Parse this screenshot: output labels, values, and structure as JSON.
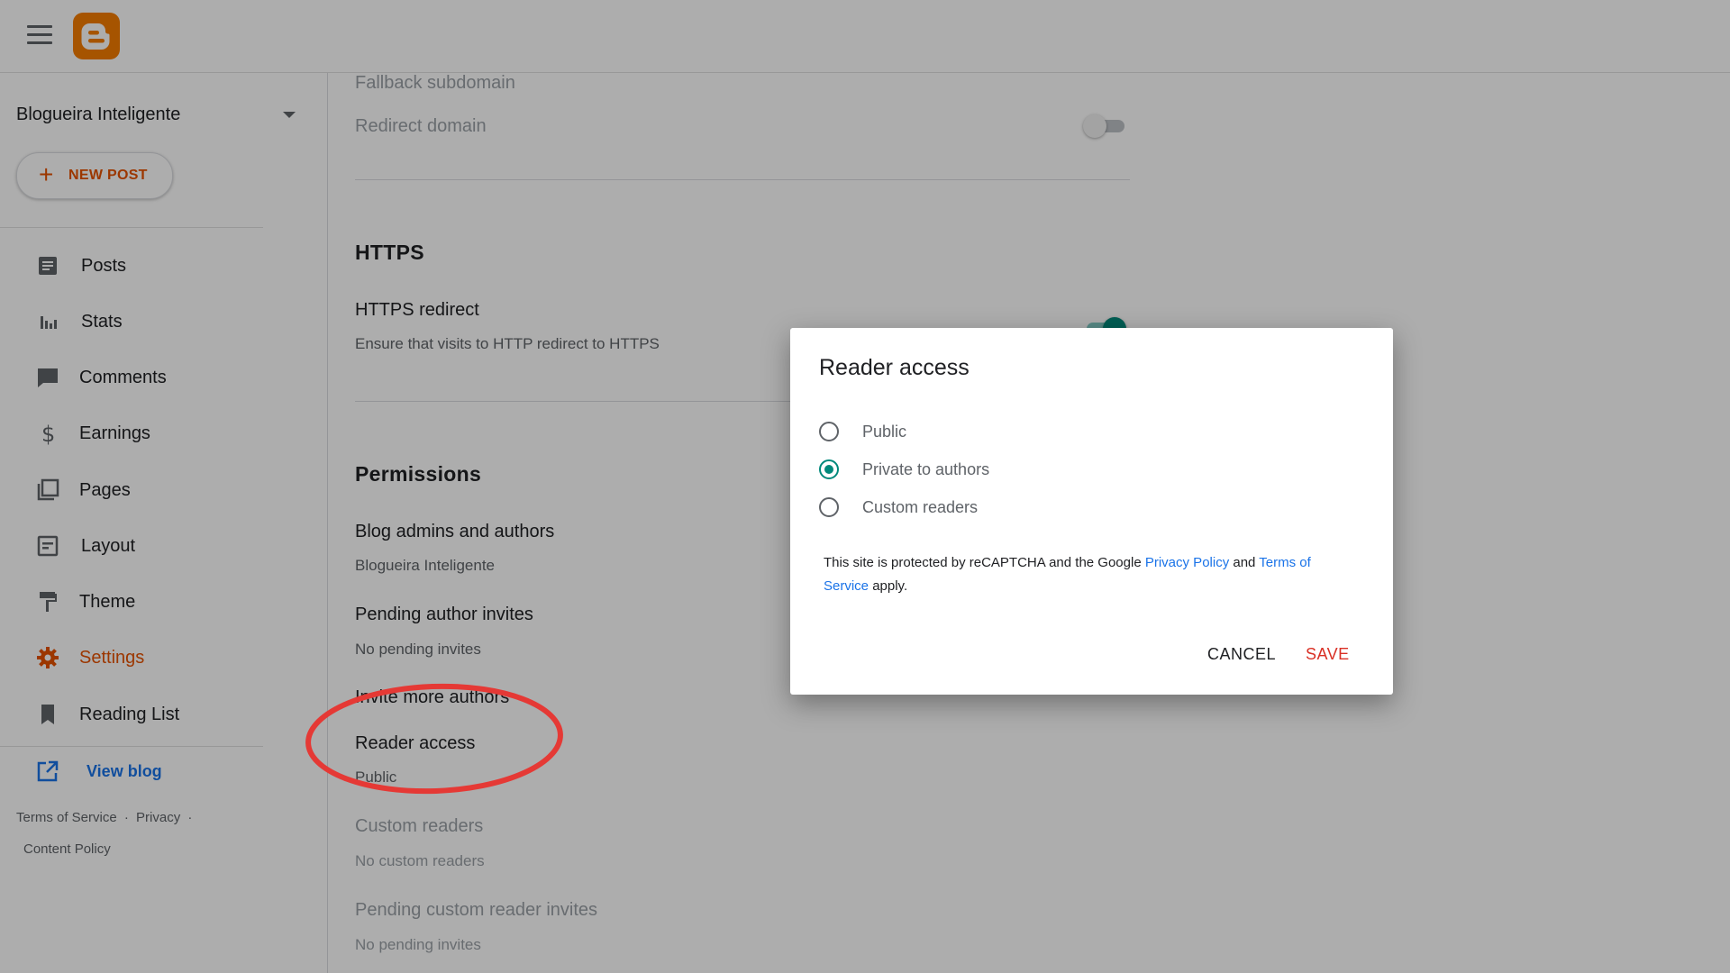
{
  "header": {
    "logo_icon": "blogger-logo-icon"
  },
  "sidebar": {
    "blog_name": "Blogueira Inteligente",
    "new_post_label": "NEW POST",
    "items": [
      {
        "label": "Posts",
        "icon": "document-icon"
      },
      {
        "label": "Stats",
        "icon": "bar-chart-icon"
      },
      {
        "label": "Comments",
        "icon": "comment-icon"
      },
      {
        "label": "Earnings",
        "icon": "dollar-icon"
      },
      {
        "label": "Pages",
        "icon": "pages-icon"
      },
      {
        "label": "Layout",
        "icon": "layout-icon"
      },
      {
        "label": "Theme",
        "icon": "paint-roller-icon"
      },
      {
        "label": "Settings",
        "icon": "gear-icon",
        "active": true
      },
      {
        "label": "Reading List",
        "icon": "bookmark-icon"
      }
    ],
    "view_blog_label": "View blog",
    "footer": {
      "terms": "Terms of Service",
      "privacy": "Privacy",
      "content_policy": "Content Policy",
      "separator": "·"
    }
  },
  "main": {
    "fallback_subdomain": "Fallback subdomain",
    "redirect_domain": "Redirect domain",
    "https_heading": "HTTPS",
    "https_redirect_title": "HTTPS redirect",
    "https_redirect_sub": "Ensure that visits to HTTP redirect to HTTPS",
    "permissions_heading": "Permissions",
    "admins_title": "Blog admins and authors",
    "admins_sub": "Blogueira Inteligente",
    "pending_author_title": "Pending author invites",
    "pending_author_sub": "No pending invites",
    "invite_more": "Invite more authors",
    "reader_access_title": "Reader access",
    "reader_access_sub": "Public",
    "custom_readers_title": "Custom readers",
    "custom_readers_sub": "No custom readers",
    "pending_reader_title": "Pending custom reader invites",
    "pending_reader_sub": "No pending invites"
  },
  "dialog": {
    "title": "Reader access",
    "options": [
      {
        "label": "Public",
        "selected": false
      },
      {
        "label": "Private to authors",
        "selected": true
      },
      {
        "label": "Custom readers",
        "selected": false
      }
    ],
    "recaptcha_pre": "This site is protected by reCAPTCHA and the Google ",
    "privacy_link": "Privacy Policy",
    "recaptcha_and": " and ",
    "terms_link": "Terms of Service",
    "recaptcha_post": " apply.",
    "cancel_label": "CANCEL",
    "save_label": "SAVE"
  },
  "colors": {
    "brand": "#f57c00",
    "accent_orange": "#e65100",
    "teal": "#00897b",
    "link": "#1a73e8",
    "save": "#d93025",
    "annotation": "#e53935"
  }
}
